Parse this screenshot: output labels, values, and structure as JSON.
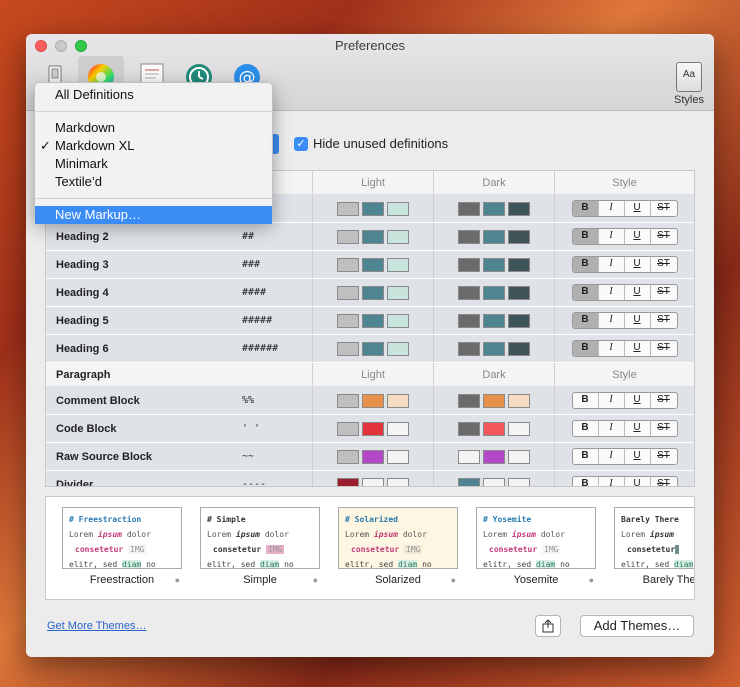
{
  "window": {
    "title": "Preferences"
  },
  "toolbar": {
    "styles_label": "Styles",
    "styles_icon_text": "Aa",
    "partial_label": "s"
  },
  "options": {
    "hide_unused": "Hide unused definitions"
  },
  "menu": {
    "all": "All Definitions",
    "items": [
      "Markdown",
      "Markdown XL",
      "Minimark",
      "Textile’d"
    ],
    "checked_index": 1,
    "new_markup": "New Markup…"
  },
  "table": {
    "columns": {
      "light": "Light",
      "dark": "Dark",
      "style": "Style"
    },
    "style_buttons": [
      "B",
      "I",
      "U",
      "ST"
    ],
    "heading_rows": [
      {
        "name": "Heading 2",
        "symbol": "##"
      },
      {
        "name": "Heading 3",
        "symbol": "###"
      },
      {
        "name": "Heading 4",
        "symbol": "####"
      },
      {
        "name": "Heading 5",
        "symbol": "#####"
      },
      {
        "name": "Heading 6",
        "symbol": "######"
      }
    ],
    "paragraph_header": "Paragraph",
    "paragraph_rows": [
      {
        "name": "Comment Block",
        "symbol": "%%"
      },
      {
        "name": "Code Block",
        "symbol": "' '"
      },
      {
        "name": "Raw Source Block",
        "symbol": "~~"
      },
      {
        "name": "Divider",
        "symbol": "----"
      }
    ]
  },
  "colors": {
    "gray": "#bfbfbf",
    "teal": "#4e8591",
    "mint": "#c8e4dc",
    "darkgray": "#6b6b6b",
    "darkslate": "#3f5458",
    "orange": "#e8914a",
    "peach": "#f6dcc0",
    "red": "#e2323c",
    "salmon": "#f4575c",
    "purple": "#b448c8",
    "white": "#f4f4f4",
    "maroon": "#9a1e30"
  },
  "themes": [
    {
      "name": "Freestraction",
      "title": "# Freestraction",
      "l1": "Lorem ",
      "l1b": "ipsum",
      "l1c": " dolor",
      "l2": "consetetur",
      "l2b": "IMG",
      "l3": "elitr, sed ",
      "l3b": "diam",
      "l3c": " no"
    },
    {
      "name": "Simple",
      "title": "# Simple",
      "l1": "Lorem ",
      "l1b": "ipsum",
      "l1c": " dolor",
      "l2": "consetetur",
      "l2b": "IMG",
      "l3": "elitr, sed ",
      "l3b": "diam",
      "l3c": " no"
    },
    {
      "name": "Solarized",
      "title": "# Solarized",
      "l1": "Lorem ",
      "l1b": "ipsum",
      "l1c": " dolor",
      "l2": "consetetur",
      "l2b": "IMG",
      "l3": "elitr, sed ",
      "l3b": "diam",
      "l3c": " no"
    },
    {
      "name": "Yosemite",
      "title": "# Yosemite",
      "l1": "Lorem ",
      "l1b": "ipsum",
      "l1c": " dolor",
      "l2": "consetetur",
      "l2b": "IMG",
      "l3": "elitr, sed ",
      "l3b": "diam",
      "l3c": " no"
    },
    {
      "name": "Barely There",
      "title": "Barely There",
      "l1": "Lorem ",
      "l1b": "ipsum",
      "l1c": "",
      "l2": "consetetur",
      "l2b": "",
      "l3": "elitr, sed ",
      "l3b": "diam",
      "l3c": ""
    }
  ],
  "footer": {
    "get_more": "Get More Themes…",
    "add_themes": "Add Themes…"
  }
}
